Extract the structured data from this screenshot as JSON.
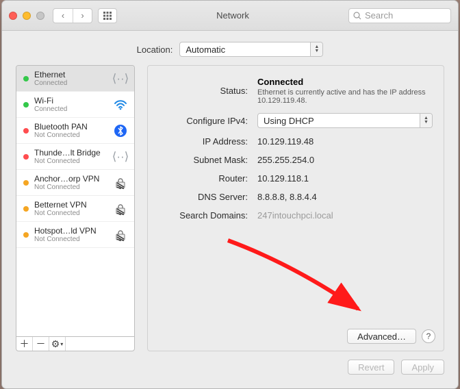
{
  "window": {
    "title": "Network"
  },
  "search": {
    "placeholder": "Search"
  },
  "location": {
    "label": "Location:",
    "value": "Automatic"
  },
  "sidebar": {
    "items": [
      {
        "name": "Ethernet",
        "status": "Connected",
        "dot": "green",
        "icon": "ethernet-icon"
      },
      {
        "name": "Wi-Fi",
        "status": "Connected",
        "dot": "green",
        "icon": "wifi-icon"
      },
      {
        "name": "Bluetooth PAN",
        "status": "Not Connected",
        "dot": "red",
        "icon": "bluetooth-icon"
      },
      {
        "name": "Thunde…lt Bridge",
        "status": "Not Connected",
        "dot": "red",
        "icon": "ethernet-icon"
      },
      {
        "name": "Anchor…orp VPN",
        "status": "Not Connected",
        "dot": "orange",
        "icon": "lock-icon"
      },
      {
        "name": "Betternet VPN",
        "status": "Not Connected",
        "dot": "orange",
        "icon": "lock-icon"
      },
      {
        "name": "Hotspot…ld VPN",
        "status": "Not Connected",
        "dot": "orange",
        "icon": "lock-icon"
      }
    ]
  },
  "detail": {
    "status_label": "Status:",
    "status_value": "Connected",
    "status_sub": "Ethernet is currently active and has the IP address 10.129.119.48.",
    "fields": {
      "configure_ipv4_label": "Configure IPv4:",
      "configure_ipv4_value": "Using DHCP",
      "ip_address_label": "IP Address:",
      "ip_address_value": "10.129.119.48",
      "subnet_mask_label": "Subnet Mask:",
      "subnet_mask_value": "255.255.254.0",
      "router_label": "Router:",
      "router_value": "10.129.118.1",
      "dns_server_label": "DNS Server:",
      "dns_server_value": "8.8.8.8, 8.8.4.4",
      "search_domains_label": "Search Domains:",
      "search_domains_value": "247intouchpci.local"
    },
    "advanced_button": "Advanced…",
    "help_button": "?"
  },
  "footer": {
    "revert_button": "Revert",
    "apply_button": "Apply"
  }
}
